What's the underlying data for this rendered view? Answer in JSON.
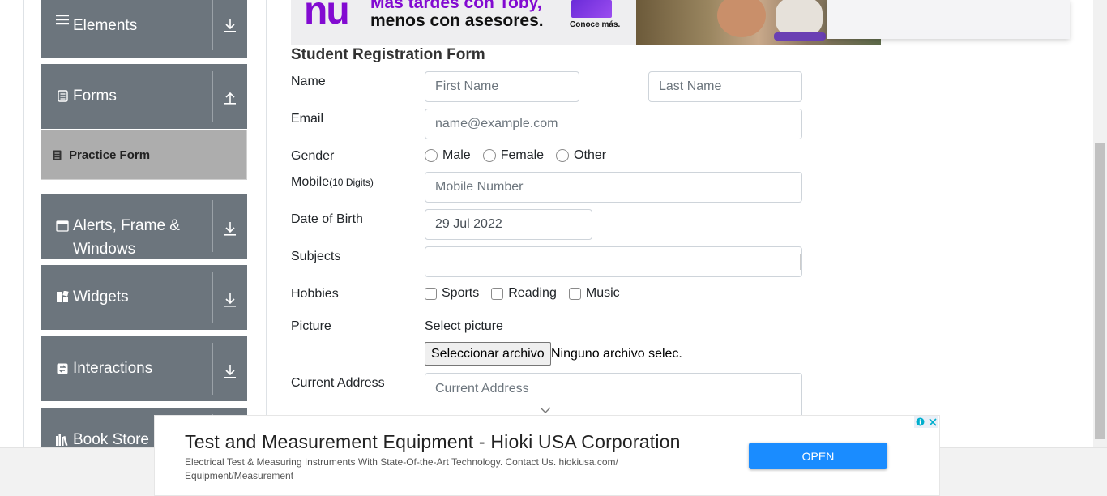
{
  "sidebar": {
    "groups": [
      {
        "label": "Elements",
        "icon": "list-icon",
        "toggle": "down"
      },
      {
        "label": "Forms",
        "icon": "document-icon",
        "toggle": "up"
      },
      {
        "label": "Alerts, Frame & Windows",
        "icon": "window-icon",
        "toggle": "down"
      },
      {
        "label": "Widgets",
        "icon": "widgets-icon",
        "toggle": "down"
      },
      {
        "label": "Interactions",
        "icon": "interactions-icon",
        "toggle": "down"
      },
      {
        "label": "Book Store",
        "icon": "books-icon",
        "toggle": "down"
      }
    ],
    "active_item": "Practice Form"
  },
  "ad_top": {
    "logo": "nu",
    "line1": "Más tardes con Toby,",
    "line2": "menos con asesores.",
    "cta": "Conoce más."
  },
  "form": {
    "title": "Student Registration Form",
    "name_label": "Name",
    "first_name_placeholder": "First Name",
    "last_name_placeholder": "Last Name",
    "email_label": "Email",
    "email_placeholder": "name@example.com",
    "gender_label": "Gender",
    "gender_options": [
      "Male",
      "Female",
      "Other"
    ],
    "mobile_label": "Mobile",
    "mobile_hint": "(10 Digits)",
    "mobile_placeholder": "Mobile Number",
    "dob_label": "Date of Birth",
    "dob_value": "29 Jul 2022",
    "subjects_label": "Subjects",
    "hobbies_label": "Hobbies",
    "hobbies_options": [
      "Sports",
      "Reading",
      "Music"
    ],
    "picture_label": "Picture",
    "select_picture": "Select picture",
    "file_button": "Seleccionar archivo",
    "file_status": "Ninguno archivo selec.",
    "address_label": "Current Address",
    "address_placeholder": "Current Address"
  },
  "ad_bottom": {
    "title": "Test and Measurement Equipment - Hioki USA Corporation",
    "description": "Electrical Test & Measuring Instruments With State-Of-the-Art Technology. Contact Us. hiokiusa.com/ Equipment/Measurement",
    "button": "OPEN"
  },
  "colors": {
    "sidebar_bg": "#6c757d",
    "active_item_bg": "#adadad",
    "ad_button": "#1a8cff"
  }
}
